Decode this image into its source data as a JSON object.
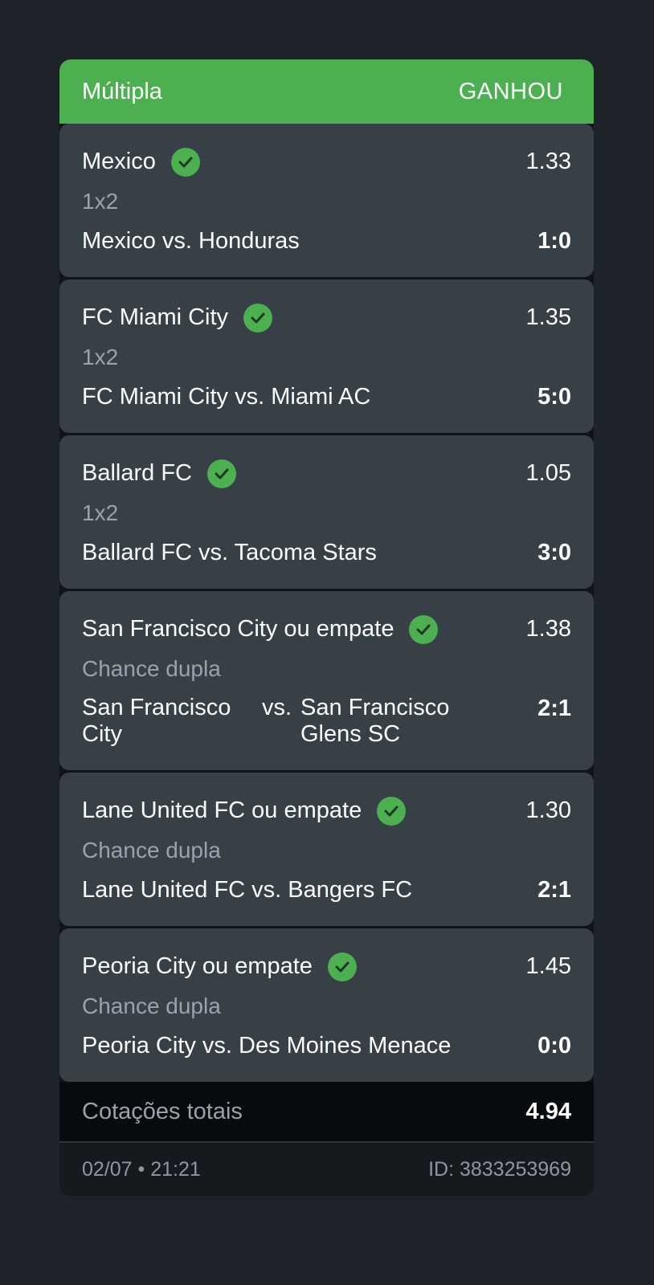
{
  "header": {
    "title": "Múltipla",
    "status": "GANHOU"
  },
  "colors": {
    "accent_green": "#4caf50",
    "card_bg": "#373f47",
    "page_bg": "#1e2329"
  },
  "selections": [
    {
      "name": "Mexico",
      "odd": "1.33",
      "market": "1x2",
      "match": "Mexico vs. Honduras",
      "score": "1:0",
      "status_icon": "check-circle-icon"
    },
    {
      "name": "FC Miami City",
      "odd": "1.35",
      "market": "1x2",
      "match": "FC Miami City vs. Miami AC",
      "score": "5:0",
      "status_icon": "check-circle-icon"
    },
    {
      "name": "Ballard FC",
      "odd": "1.05",
      "market": "1x2",
      "match": "Ballard FC vs. Tacoma Stars",
      "score": "3:0",
      "status_icon": "check-circle-icon"
    },
    {
      "name": "San Francisco City ou empate",
      "odd": "1.38",
      "market": "Chance dupla",
      "home": "San Francisco City",
      "vs": "vs.",
      "away": "San Francisco Glens SC",
      "score": "2:1",
      "status_icon": "check-circle-icon"
    },
    {
      "name": "Lane United FC ou empate",
      "odd": "1.30",
      "market": "Chance dupla",
      "match": "Lane United FC vs. Bangers FC",
      "score": "2:1",
      "status_icon": "check-circle-icon"
    },
    {
      "name": "Peoria City ou empate",
      "odd": "1.45",
      "market": "Chance dupla",
      "match": "Peoria City vs. Des Moines Menace",
      "score": "0:0",
      "status_icon": "check-circle-icon"
    }
  ],
  "totals": {
    "label": "Cotações totais",
    "value": "4.94"
  },
  "footer": {
    "date": "02/07 • 21:21",
    "id": "ID: 3833253969"
  }
}
